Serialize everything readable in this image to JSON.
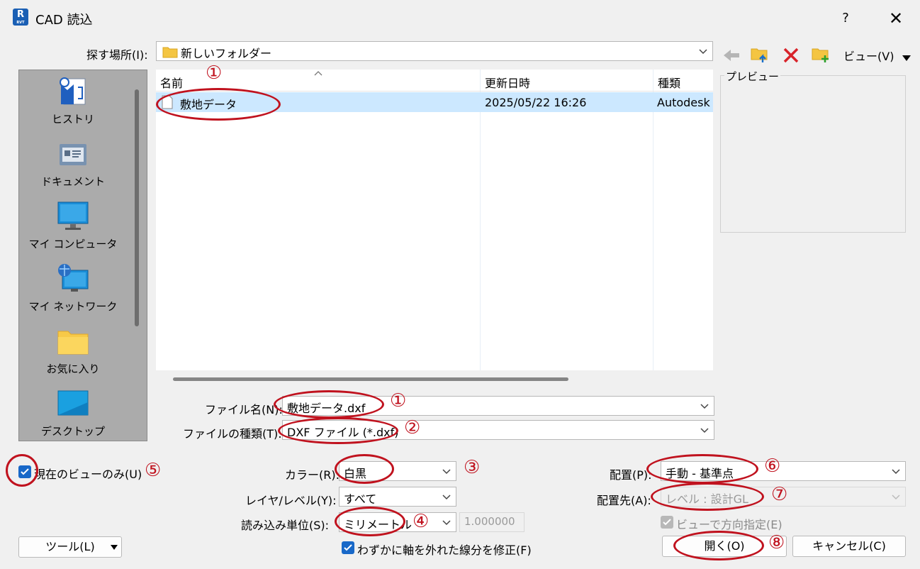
{
  "window": {
    "app_icon_letter": "R",
    "app_icon_small": "RVT",
    "title": "CAD 読込",
    "help": "?",
    "close": "✕"
  },
  "lookin": {
    "label": "探す場所(I):",
    "value": "新しいフォルダー"
  },
  "toolbar": {
    "view_label": "ビュー(V)"
  },
  "places": [
    {
      "label": "ヒストリ",
      "icon": "history-icon"
    },
    {
      "label": "ドキュメント",
      "icon": "documents-icon"
    },
    {
      "label": "マイ コンピュータ",
      "icon": "computer-icon"
    },
    {
      "label": "マイ ネットワーク",
      "icon": "network-icon"
    },
    {
      "label": "お気に入り",
      "icon": "favorites-folder-icon"
    },
    {
      "label": "デスクトップ",
      "icon": "desktop-icon"
    }
  ],
  "file_list": {
    "columns": [
      "名前",
      "更新日時",
      "種類"
    ],
    "rows": [
      {
        "name": "敷地データ",
        "modified": "2025/05/22 16:26",
        "type": "Autodesk"
      }
    ]
  },
  "preview": {
    "label": "プレビュー"
  },
  "filename": {
    "label": "ファイル名(N):",
    "value": "敷地データ.dxf"
  },
  "filetype": {
    "label": "ファイルの種類(T):",
    "value": "DXF ファイル (*.dxf)"
  },
  "options": {
    "current_view_only": "現在のビューのみ(U)",
    "color_label": "カラー(R):",
    "color_value": "白黒",
    "layer_label": "レイヤ/レベル(Y):",
    "layer_value": "すべて",
    "units_label": "読み込み単位(S):",
    "units_value": "ミリメートル",
    "units_factor": "1.000000",
    "correct_lines": "わずかに軸を外れた線分を修正(F)",
    "positioning_label": "配置(P):",
    "positioning_value": "手動 - 基準点",
    "place_at_label": "配置先(A):",
    "place_at_value": "レベル : 設計GL",
    "orient_to_view": "ビューで方向指定(E)"
  },
  "buttons": {
    "tools": "ツール(L)",
    "open": "開く(O)",
    "cancel": "キャンセル(C)"
  },
  "annotations": [
    "①",
    "①",
    "②",
    "③",
    "④",
    "⑤",
    "⑥",
    "⑦",
    "⑧"
  ],
  "colors": {
    "annotation_red": "#c0121e",
    "selection": "#cce8ff",
    "checkbox": "#1868c8"
  }
}
